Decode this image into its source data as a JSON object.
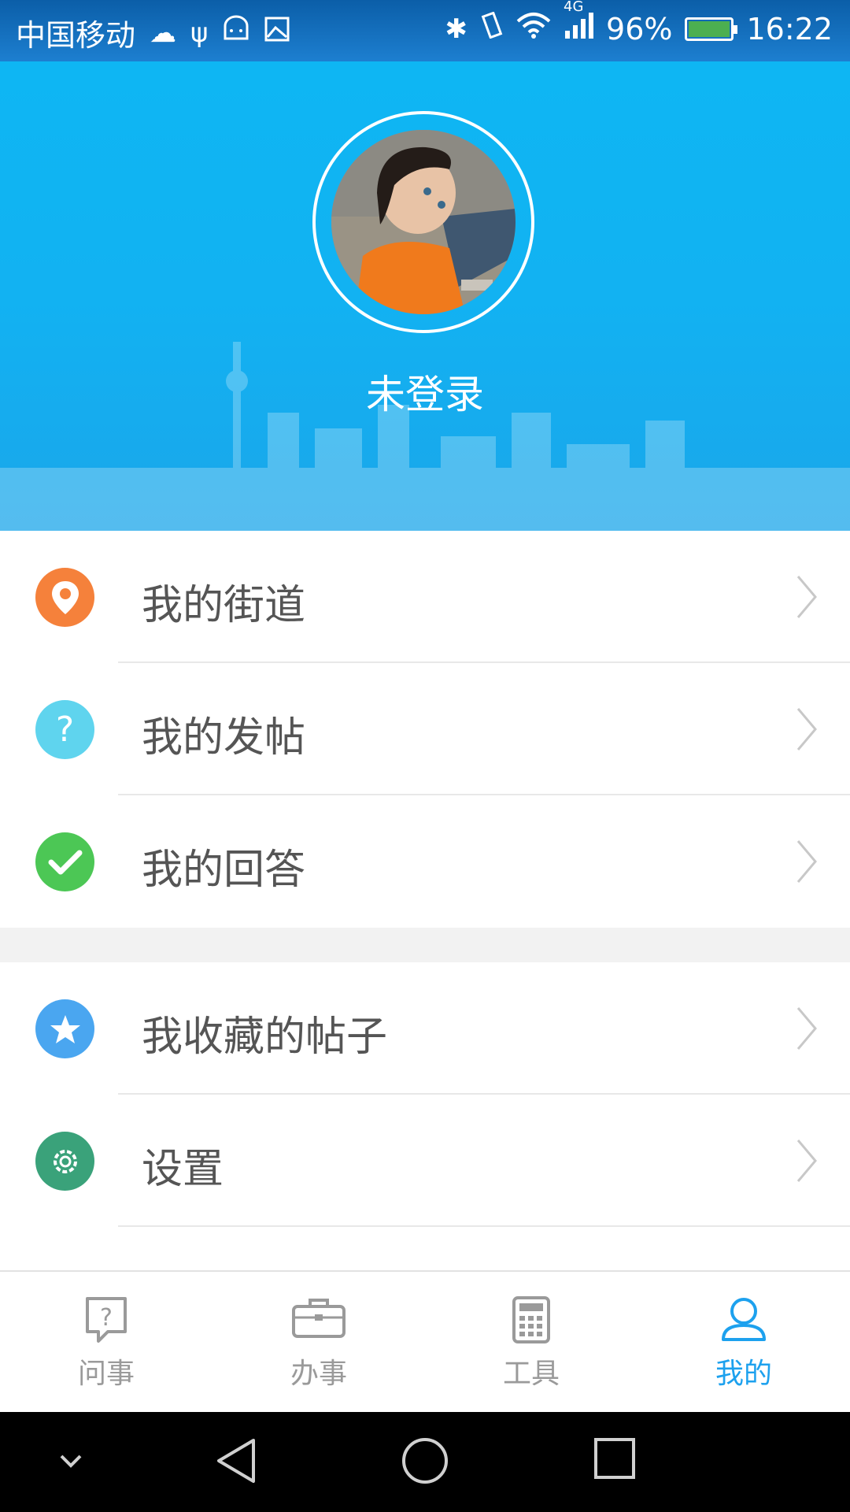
{
  "status_bar": {
    "carrier": "中国移动",
    "network": "4G",
    "battery": "96%",
    "time": "16:22",
    "battery_level": 0.96,
    "icons": [
      "weather-icon",
      "usb-icon",
      "android-icon",
      "image-icon",
      "bluetooth-icon",
      "vibrate-icon",
      "wifi-icon",
      "signal-icon",
      "battery-icon"
    ]
  },
  "profile": {
    "name": "未登录",
    "avatar_icon": "avatar-photo"
  },
  "menu": {
    "group1": [
      {
        "label": "我的街道",
        "icon": "location-pin-icon",
        "color": "#f5813b"
      },
      {
        "label": "我的发帖",
        "icon": "question-icon",
        "color": "#5fd4ee"
      },
      {
        "label": "我的回答",
        "icon": "check-icon",
        "color": "#4cc755"
      }
    ],
    "group2": [
      {
        "label": "我收藏的帖子",
        "icon": "star-icon",
        "color": "#4aa6f0"
      },
      {
        "label": "设置",
        "icon": "gear-icon",
        "color": "#3aa27a"
      }
    ]
  },
  "tabs": [
    {
      "label": "问事",
      "icon": "question-bubble-icon",
      "active": false
    },
    {
      "label": "办事",
      "icon": "briefcase-icon",
      "active": false
    },
    {
      "label": "工具",
      "icon": "calculator-icon",
      "active": false
    },
    {
      "label": "我的",
      "icon": "user-icon",
      "active": true
    }
  ],
  "colors": {
    "header": "#12b2f2",
    "accent": "#1da1ee",
    "text": "#555555"
  }
}
